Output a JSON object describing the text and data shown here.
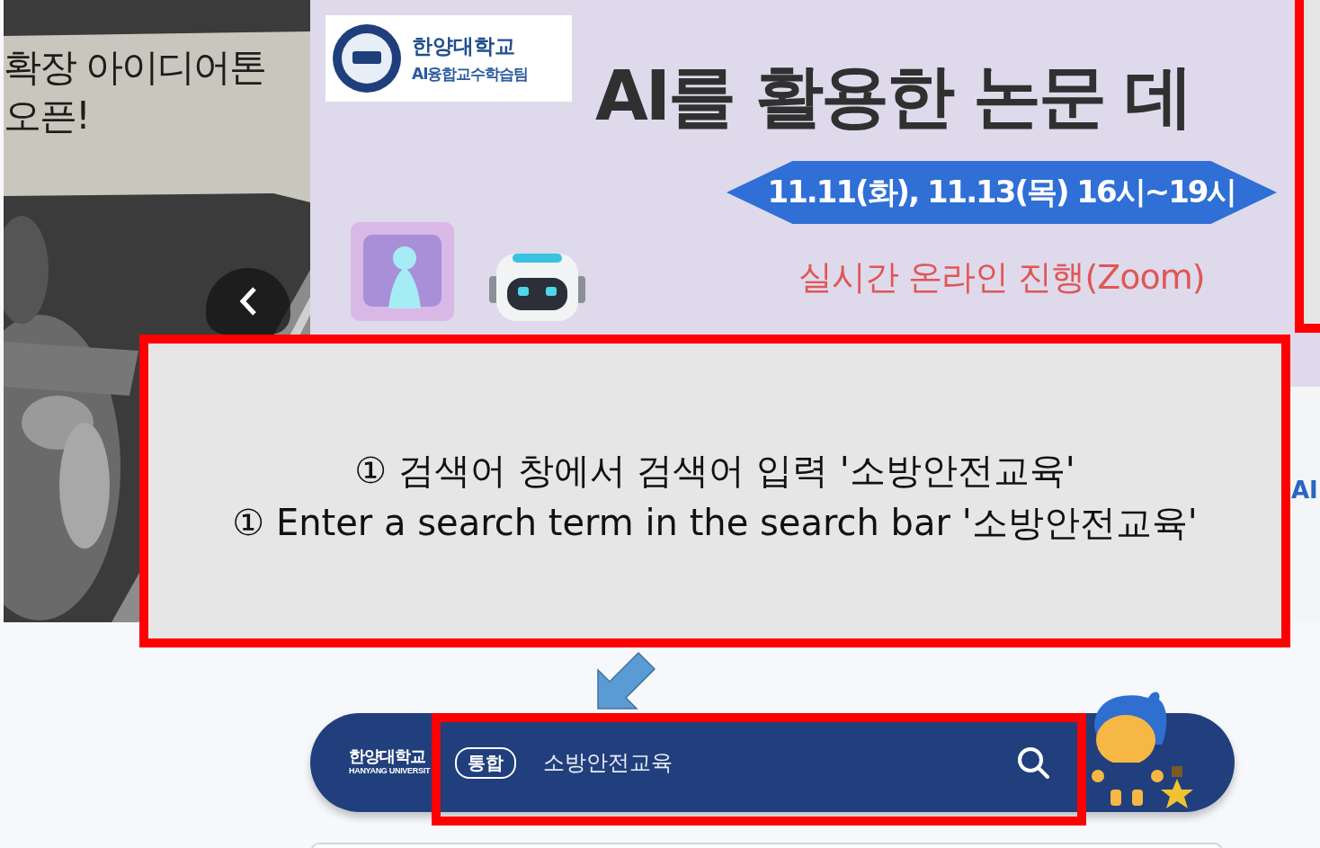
{
  "photo_banner": {
    "kind": "picture",
    "lines": [
      "확장 아이디어톤",
      "오픈!"
    ]
  },
  "main_banner": {
    "logo_name": "한양대학교",
    "logo_team": "AI융합교수학습팀",
    "headline": "AI를 활용한 논문 데",
    "date": "11.11(화), 11.13(목) 16시~19시",
    "mode": "실시간 온라인 진행(Zoom)"
  },
  "side_banner": {
    "text": "AI"
  },
  "annotation": {
    "lines": [
      "① 검색어 창에서 검색어 입력 '소방안전교육'",
      "① Enter a search term in the search bar '소방안전교육'"
    ]
  },
  "search_bar": {
    "logo": "한양대학교",
    "logo_sub": "HANYANG UNIVERSIT",
    "scope": "통합",
    "value": "소방안전교육"
  }
}
